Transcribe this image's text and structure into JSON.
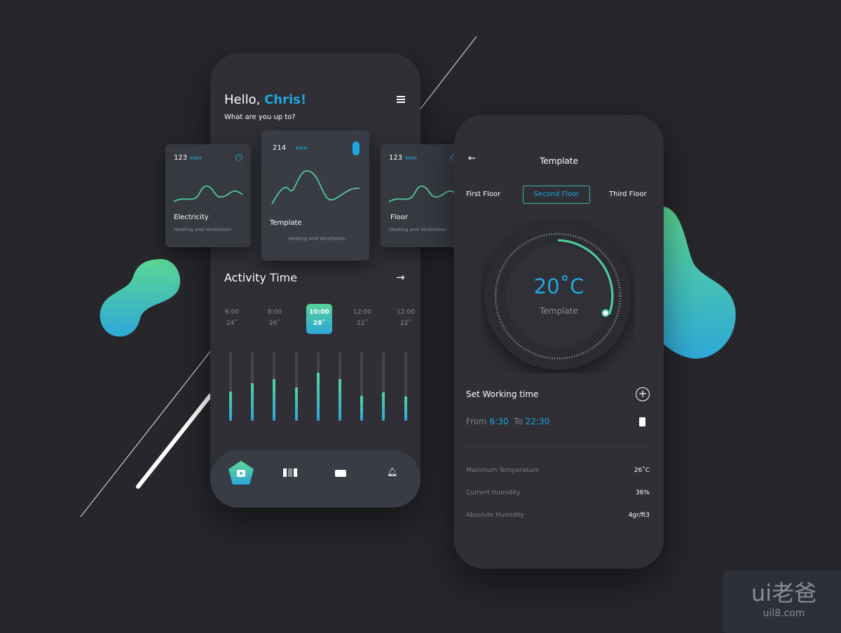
{
  "left_phone": {
    "greeting": "Hello,",
    "name": "Chris!",
    "subtitle": "What are you up to?",
    "cards": [
      {
        "value": "123",
        "unit": "KWH",
        "title": "Electricity",
        "subtitle": "Heating and Ventilation",
        "icon": "plug-icon"
      },
      {
        "value": "214",
        "unit": "KWH",
        "title": "Template",
        "subtitle": "Heating and Ventilation",
        "icon": "thermometer-icon"
      },
      {
        "value": "123",
        "unit": "KWH",
        "title": "Floor",
        "subtitle": "Heating and Ventilation",
        "icon": "plug-icon"
      }
    ],
    "activity_title": "Activity Time",
    "timeline": [
      {
        "time": "6:00",
        "temp": "24˚"
      },
      {
        "time": "8:00",
        "temp": "26˚"
      },
      {
        "time": "10:00",
        "temp": "28˚",
        "selected": true
      },
      {
        "time": "12:00",
        "temp": "22˚"
      },
      {
        "time": "12:00",
        "temp": "22˚"
      }
    ],
    "bar_levels": [
      0.43,
      0.55,
      0.61,
      0.49,
      0.7,
      0.61,
      0.37,
      0.42,
      0.36
    ],
    "nav": [
      "home-icon",
      "columns-icon",
      "wallet-icon",
      "bell-icon"
    ]
  },
  "right_phone": {
    "title": "Template",
    "tabs": [
      "First Floor",
      "Second Floor",
      "Third Floor"
    ],
    "selected_tab": "Second Floor",
    "temperature": "20˚C",
    "dial_label": "Template",
    "working_time_label": "Set Working time",
    "from_label": "From",
    "from": "6:30",
    "to_label": "To",
    "to": "22:30",
    "stats": [
      {
        "label": "Maximum Temperature",
        "value": "26˚C"
      },
      {
        "label": "Current Humidity",
        "value": "36%"
      },
      {
        "label": "Absolute Humidity",
        "value": "4gr/ft3"
      }
    ]
  },
  "colors": {
    "accent": "#1fa8e0",
    "green": "#55d39a",
    "background": "#26262b"
  },
  "watermark": {
    "logo": "ui老爸",
    "url": "uil8.com"
  }
}
